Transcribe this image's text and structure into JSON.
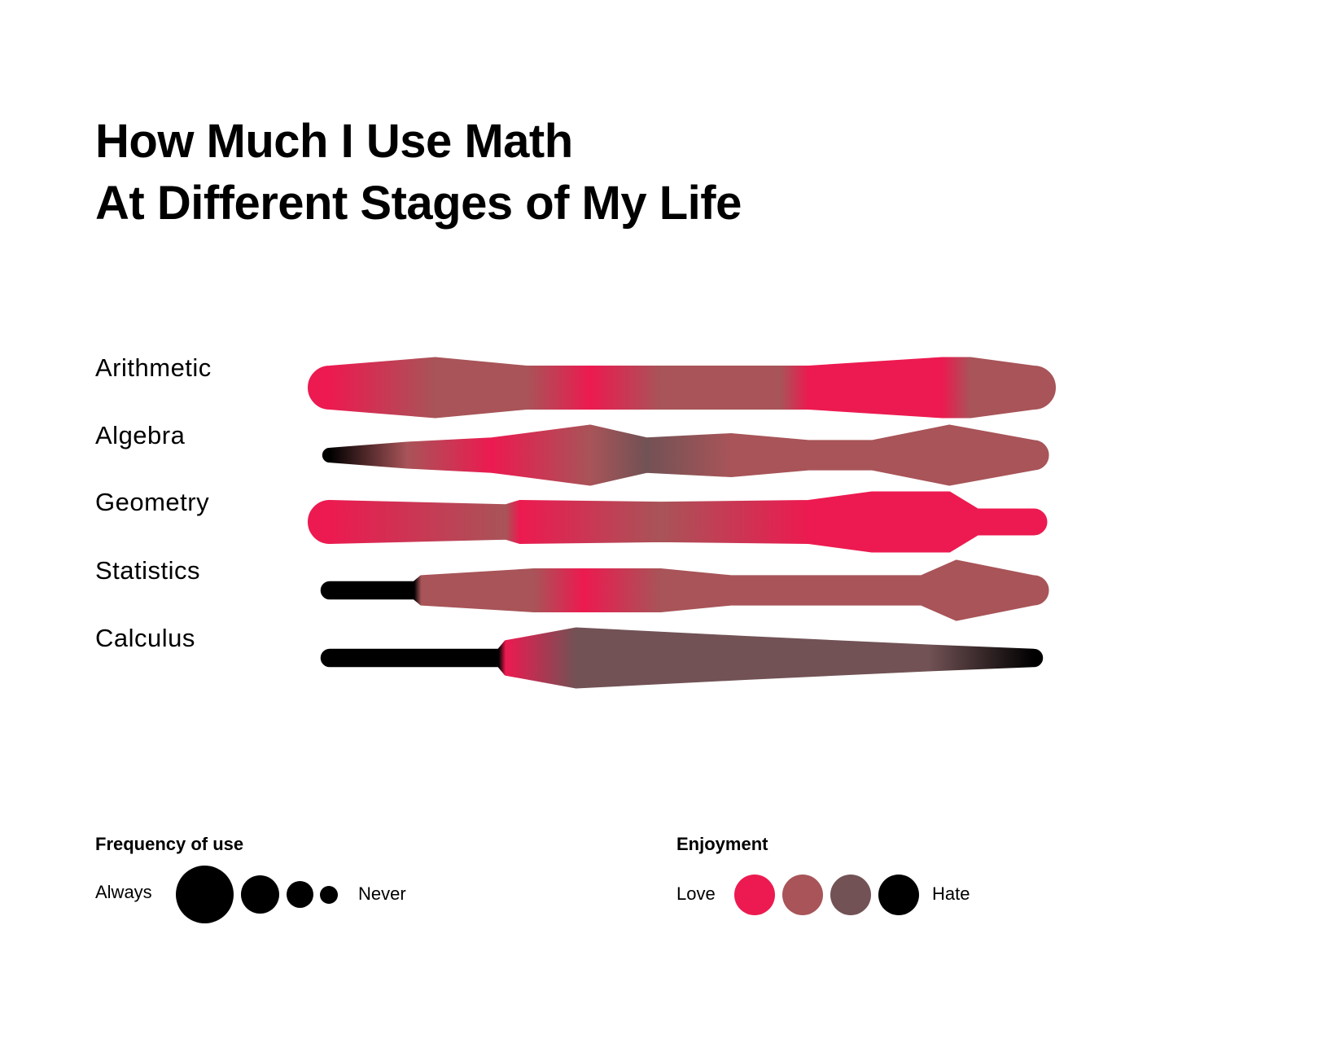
{
  "title_line1": "How Much I Use Math",
  "title_line2": "At Different Stages of My Life",
  "chart_data": {
    "type": "stream",
    "title": "How Much I Use Math At Different Stages of My Life",
    "categories": [
      "Arithmetic",
      "Algebra",
      "Geometry",
      "Statistics",
      "Calculus"
    ],
    "frequency_scale": {
      "min": 0,
      "max": 3,
      "meaning": "0 = Never, 3 = Always"
    },
    "enjoyment_scale": {
      "min": 0,
      "max": 3,
      "meaning": "0 = Love, 3 = Hate"
    },
    "series": [
      {
        "name": "Arithmetic",
        "points": [
          {
            "t": 0.0,
            "frequency": 2.0,
            "enjoyment": 0.0
          },
          {
            "t": 0.15,
            "frequency": 3.0,
            "enjoyment": 1.0
          },
          {
            "t": 0.28,
            "frequency": 2.0,
            "enjoyment": 1.0
          },
          {
            "t": 0.37,
            "frequency": 2.0,
            "enjoyment": 0.0
          },
          {
            "t": 0.47,
            "frequency": 2.0,
            "enjoyment": 1.0
          },
          {
            "t": 0.64,
            "frequency": 2.0,
            "enjoyment": 1.0
          },
          {
            "t": 0.68,
            "frequency": 2.0,
            "enjoyment": 0.0
          },
          {
            "t": 0.87,
            "frequency": 3.0,
            "enjoyment": 0.0
          },
          {
            "t": 0.91,
            "frequency": 3.0,
            "enjoyment": 1.0
          },
          {
            "t": 1.0,
            "frequency": 2.0,
            "enjoyment": 1.0
          }
        ]
      },
      {
        "name": "Algebra",
        "points": [
          {
            "t": 0.0,
            "frequency": 0.3,
            "enjoyment": 3.0
          },
          {
            "t": 0.11,
            "frequency": 1.0,
            "enjoyment": 1.0
          },
          {
            "t": 0.23,
            "frequency": 1.5,
            "enjoyment": 0.0
          },
          {
            "t": 0.37,
            "frequency": 3.0,
            "enjoyment": 1.0
          },
          {
            "t": 0.45,
            "frequency": 1.5,
            "enjoyment": 2.0
          },
          {
            "t": 0.57,
            "frequency": 2.0,
            "enjoyment": 1.0
          },
          {
            "t": 0.68,
            "frequency": 1.2,
            "enjoyment": 1.0
          },
          {
            "t": 0.77,
            "frequency": 1.2,
            "enjoyment": 1.0
          },
          {
            "t": 0.88,
            "frequency": 3.0,
            "enjoyment": 1.0
          },
          {
            "t": 1.0,
            "frequency": 1.2,
            "enjoyment": 1.0
          }
        ]
      },
      {
        "name": "Geometry",
        "points": [
          {
            "t": 0.0,
            "frequency": 2.0,
            "enjoyment": 0.0
          },
          {
            "t": 0.25,
            "frequency": 1.5,
            "enjoyment": 1.0
          },
          {
            "t": 0.27,
            "frequency": 2.0,
            "enjoyment": 0.0
          },
          {
            "t": 0.47,
            "frequency": 1.8,
            "enjoyment": 1.0
          },
          {
            "t": 0.68,
            "frequency": 2.0,
            "enjoyment": 0.0
          },
          {
            "t": 0.77,
            "frequency": 3.0,
            "enjoyment": 0.0
          },
          {
            "t": 0.88,
            "frequency": 3.0,
            "enjoyment": 0.0
          },
          {
            "t": 0.92,
            "frequency": 1.0,
            "enjoyment": 0.0
          },
          {
            "t": 1.0,
            "frequency": 1.0,
            "enjoyment": 0.0
          }
        ]
      },
      {
        "name": "Statistics",
        "points": [
          {
            "t": 0.0,
            "frequency": 0.5,
            "enjoyment": 3.0
          },
          {
            "t": 0.12,
            "frequency": 0.5,
            "enjoyment": 3.0
          },
          {
            "t": 0.13,
            "frequency": 1.2,
            "enjoyment": 1.0
          },
          {
            "t": 0.29,
            "frequency": 2.0,
            "enjoyment": 1.0
          },
          {
            "t": 0.36,
            "frequency": 2.0,
            "enjoyment": 0.0
          },
          {
            "t": 0.47,
            "frequency": 2.0,
            "enjoyment": 1.0
          },
          {
            "t": 0.57,
            "frequency": 1.2,
            "enjoyment": 1.0
          },
          {
            "t": 0.84,
            "frequency": 1.2,
            "enjoyment": 1.0
          },
          {
            "t": 0.89,
            "frequency": 3.0,
            "enjoyment": 1.0
          },
          {
            "t": 1.0,
            "frequency": 1.2,
            "enjoyment": 1.0
          }
        ]
      },
      {
        "name": "Calculus",
        "points": [
          {
            "t": 0.0,
            "frequency": 0.5,
            "enjoyment": 3.0
          },
          {
            "t": 0.24,
            "frequency": 0.5,
            "enjoyment": 3.0
          },
          {
            "t": 0.25,
            "frequency": 1.5,
            "enjoyment": 0.0
          },
          {
            "t": 0.35,
            "frequency": 3.0,
            "enjoyment": 2.0
          },
          {
            "t": 0.59,
            "frequency": 2.0,
            "enjoyment": 2.0
          },
          {
            "t": 0.85,
            "frequency": 1.0,
            "enjoyment": 2.0
          },
          {
            "t": 1.0,
            "frequency": 0.5,
            "enjoyment": 3.0
          }
        ]
      }
    ],
    "legend": {
      "frequency": {
        "title": "Frequency of use",
        "low_label": "Never",
        "high_label": "Always",
        "levels": [
          3,
          2,
          1,
          0
        ]
      },
      "enjoyment": {
        "title": "Enjoyment",
        "low_label": "Love",
        "high_label": "Hate",
        "levels": [
          0,
          1,
          2,
          3
        ]
      }
    },
    "colors": {
      "love": "#ec1a50",
      "like": "#a85458",
      "dislike": "#725255",
      "hate": "#000000"
    }
  }
}
